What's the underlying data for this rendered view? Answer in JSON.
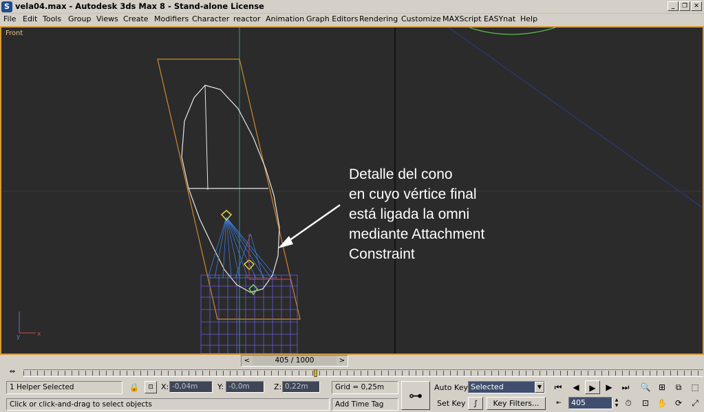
{
  "window": {
    "title": "vela04.max - Autodesk 3ds Max 8  - Stand-alone License",
    "app_icon": "3ds-max-logo",
    "buttons": {
      "minimize": "_",
      "restore": "❐",
      "close": "✕"
    }
  },
  "menu": [
    "File",
    "Edit",
    "Tools",
    "Group",
    "Views",
    "Create",
    "Modifiers",
    "Character",
    "reactor",
    "Animation",
    "Graph Editors",
    "Rendering",
    "Customize",
    "MAXScript",
    "EASYnat",
    "Help"
  ],
  "viewport": {
    "label": "Front",
    "annotation_lines": [
      "Detalle del cono",
      "en cuyo vértice final",
      "está ligada la omni",
      "mediante Attachment",
      "Constraint"
    ],
    "axis_labels": {
      "y": "y",
      "x": "x"
    }
  },
  "time_slider": {
    "label": "405 / 1000",
    "prev": "<",
    "next": ">"
  },
  "status": {
    "selection": "1 Helper Selected",
    "prompt": "Click or click-and-drag to select objects",
    "coords": {
      "x_label": "X:",
      "x": "-0,04m",
      "y_label": "Y:",
      "y": "-0,0m",
      "z_label": "Z:",
      "z": "0,22m"
    },
    "grid": "Grid = 0,25m",
    "add_time_tag": "Add Time Tag"
  },
  "animation": {
    "auto_key": "Auto Key",
    "set_key": "Set Key",
    "selected": "Selected",
    "key_filters": "Key Filters...",
    "current_frame": "405"
  },
  "colors": {
    "viewport_bg": "#2b2b2b",
    "viewport_border": "#d99a3a",
    "field_blue": "#3f4e6e",
    "annotation_text": "#ffffff"
  }
}
